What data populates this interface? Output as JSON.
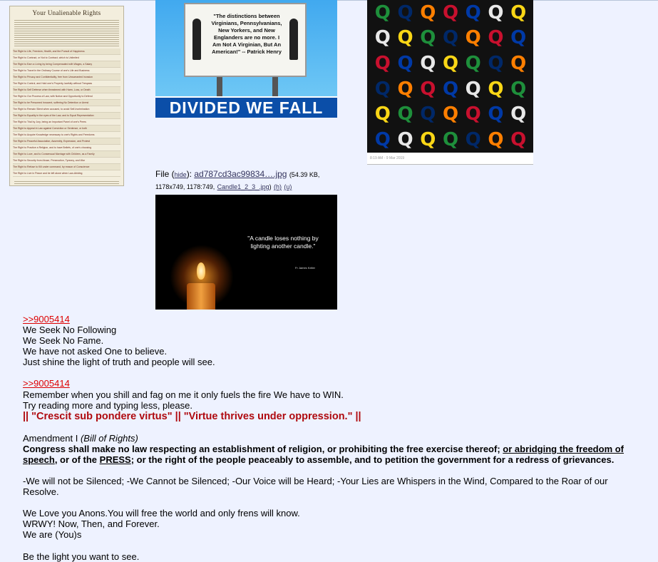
{
  "poster": {
    "title": "Your Unalienable Rights",
    "rows": [
      "The Right to Life, Freedom, Health, and the Pursuit of Happiness",
      "The Right to Contract, or Not to Contract, which is Unlimited",
      "The Right to Earn a Living by being Compensated with Wages, a Salary",
      "The Right to Travel in the Ordinary Course of one's Life and Business",
      "The Right to Privacy and Confidentiality, free from Unwarranted Invasion",
      "The Right to Control, and Hold one's Property, lawfully without Trespass",
      "The Right to Self Defense when threatened with Harm, Loss, or Death",
      "The Right to Our Process of Law, with Notice and Opportunity to Defend",
      "The Right to be Presumed Innocent, suffering No Detention or Arrest",
      "The Right to Remain Silent when accused, to avoid Self-Incrimination",
      "The Right to Equality in the eyes of the Law, and to Equal Representation",
      "The Right to Trial by Jury, being an Important Panel of one's Peers",
      "The Right to Appeal in Law against Conviction or Sentence, or both",
      "The Right to Acquire Knowledge necessary to one's Rights and Freedoms",
      "The Right to Peaceful Association, Assembly, Expression, and Protest",
      "The Right to Practice a Religion, and to have Beliefs, of one's choosing",
      "The Right to Love, and to Consensual Marriage with Children, as a Family",
      "The Right to Security from Abuse, Persecution, Tyranny, and War",
      "The Right to Refuse to Kill under command, by reason of Conscience",
      "The Right to Live in Peace and be left alone when Law-Abiding"
    ]
  },
  "billboard": {
    "quote": "\"The distinctions between Virginians, Pennsylvanians, New Yorkers, and New Englanders are no more. I Am Not A Virginian, But An American!\" -- Patrick Henry",
    "banner": "DIVIDED WE FALL"
  },
  "qgrid": {
    "letter": "Q",
    "colors": [
      "#1e8f3b",
      "#e8e8e8",
      "#c8102e",
      "#002868",
      "#f9d616",
      "#0039a6",
      "#ff7f00"
    ],
    "caption": "8:19 AM - 9 Mar 2019"
  },
  "file": {
    "prefix": "File (",
    "hide": "hide",
    "mid": "): ",
    "name": "ad787cd3ac99834….jpg",
    "meta": "(54.39 KB, 1178x749, 1178:749,",
    "orig": "Candle1_2_3_.jpg",
    "h": "(h)",
    "u": "(u)"
  },
  "candle": {
    "quote": "\"A candle loses nothing by lighting another candle.\"",
    "attr": "Fr James Keller"
  },
  "post": {
    "link1": ">>9005414",
    "l1": "We Seek No Following",
    "l2": "We Seek No Fame.",
    "l3": "We have not asked One to believe.",
    "l4": "Just shine the light of truth and people will see.",
    "link2": ">>9005414",
    "l5": "Remember when you shill and fag on me it only fuels the fire We have to WIN.",
    "l6": "Try reading more and typing less, please.",
    "red": "|| \"Crescit sub pondere virtus\" || \"Virtue thrives under oppression.\" ||",
    "amend": "Amendment I ",
    "amend_i": "(Bill of Rights)",
    "congress_a": "Congress shall make no law respecting an establishment of religion, or prohibiting the free exercise thereof; ",
    "congress_u": "or abridging the freedom of speech",
    "congress_b": ", or of the ",
    "congress_press": "PRESS",
    "congress_c": "; or the right of the people peaceably to assemble, and to petition the government for a redress of grievances.",
    "silenced": "-We will not be Silenced;  -We Cannot be Silenced;  -Our Voice will be Heard;   -Your Lies are Whispers in the Wind, Compared to the Roar of our Resolve.",
    "love": "We Love you Anons.You will free the world and only frens will know.",
    "wrwy": "WRWY! Now, Then, and Forever.",
    "weare": "We are (You)s",
    "light": "Be the light you want to see."
  }
}
